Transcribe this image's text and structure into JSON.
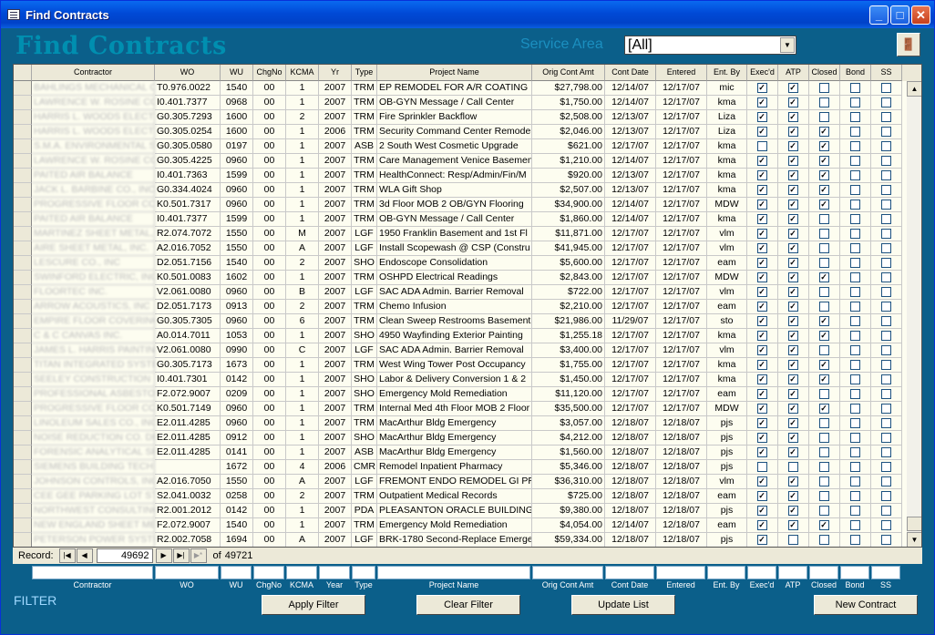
{
  "window": {
    "title": "Find Contracts"
  },
  "header": {
    "title": "Find Contracts",
    "service_area_label": "Service Area",
    "service_area_value": "[All]"
  },
  "grid": {
    "columns": [
      "Contractor",
      "WO",
      "WU",
      "ChgNo",
      "KCMA",
      "Yr",
      "Type",
      "Project Name",
      "Orig Cont  Amt",
      "Cont Date",
      "Entered",
      "Ent. By",
      "Exec'd",
      "ATP",
      "Closed",
      "Bond",
      "SS"
    ],
    "rows": [
      [
        "BAHLINGS MECHANICAL C",
        "T0.976.0022",
        "1540",
        "00",
        "1",
        "2007",
        "TRM",
        "EP REMODEL FOR A/R COATING",
        "$27,798.00",
        "12/14/07",
        "12/17/07",
        "mic",
        1,
        1,
        0,
        0,
        0
      ],
      [
        "LAWRENCE W. ROSINE CO",
        "I0.401.7377",
        "0968",
        "00",
        "1",
        "2007",
        "TRM",
        "OB-GYN Message / Call Center",
        "$1,750.00",
        "12/14/07",
        "12/17/07",
        "kma",
        1,
        1,
        0,
        0,
        0
      ],
      [
        "HARRIS L. WOODS ELECT",
        "G0.305.7293",
        "1600",
        "00",
        "2",
        "2007",
        "TRM",
        "Fire Sprinkler Backflow",
        "$2,508.00",
        "12/13/07",
        "12/17/07",
        "Liza",
        1,
        1,
        0,
        0,
        0
      ],
      [
        "HARRIS L. WOODS ELECT",
        "G0.305.0254",
        "1600",
        "00",
        "1",
        "2006",
        "TRM",
        "Security Command Center Remode",
        "$2,046.00",
        "12/13/07",
        "12/17/07",
        "Liza",
        1,
        1,
        1,
        0,
        0
      ],
      [
        "S.M.A. ENVIRONMENTAL S",
        "G0.305.0580",
        "0197",
        "00",
        "1",
        "2007",
        "ASB",
        "2 South West Cosmetic Upgrade",
        "$621.00",
        "12/17/07",
        "12/17/07",
        "kma",
        0,
        1,
        1,
        0,
        0
      ],
      [
        "LAWRENCE W. ROSINE CO",
        "G0.305.4225",
        "0960",
        "00",
        "1",
        "2007",
        "TRM",
        "Care Management Venice Basemen",
        "$1,210.00",
        "12/14/07",
        "12/17/07",
        "kma",
        1,
        1,
        1,
        0,
        0
      ],
      [
        "PAITED AIR BALANCE",
        "I0.401.7363",
        "1599",
        "00",
        "1",
        "2007",
        "TRM",
        "HealthConnect: Resp/Admin/Fin/M",
        "$920.00",
        "12/13/07",
        "12/17/07",
        "kma",
        1,
        1,
        1,
        0,
        0
      ],
      [
        "JACK L. BARBINE CO., INC",
        "G0.334.4024",
        "0960",
        "00",
        "1",
        "2007",
        "TRM",
        "WLA Gift Shop",
        "$2,507.00",
        "12/13/07",
        "12/17/07",
        "kma",
        1,
        1,
        1,
        0,
        0
      ],
      [
        "PROGRESSIVE FLOOR COV",
        "K0.501.7317",
        "0960",
        "00",
        "1",
        "2007",
        "TRM",
        "3d Floor MOB 2 OB/GYN Flooring",
        "$34,900.00",
        "12/14/07",
        "12/17/07",
        "MDW",
        1,
        1,
        1,
        0,
        0
      ],
      [
        "PAITED AIR BALANCE",
        "I0.401.7377",
        "1599",
        "00",
        "1",
        "2007",
        "TRM",
        "OB-GYN Message / Call Center",
        "$1,860.00",
        "12/14/07",
        "12/17/07",
        "kma",
        1,
        1,
        0,
        0,
        0
      ],
      [
        "MARTINEZ SHEET METAL, I",
        "R2.074.7072",
        "1550",
        "00",
        "M",
        "2007",
        "LGF",
        "1950 Franklin Basement and 1st Fl",
        "$11,871.00",
        "12/17/07",
        "12/17/07",
        "vlm",
        1,
        1,
        0,
        0,
        0
      ],
      [
        "AIRE SHEET METAL, INC.",
        "A2.016.7052",
        "1550",
        "00",
        "A",
        "2007",
        "LGF",
        "Install Scopewash @ CSP (Constru",
        "$41,945.00",
        "12/17/07",
        "12/17/07",
        "vlm",
        1,
        1,
        0,
        0,
        0
      ],
      [
        "LESCURE CO., INC",
        "D2.051.7156",
        "1540",
        "00",
        "2",
        "2007",
        "SHO",
        "Endoscope Consolidation",
        "$5,600.00",
        "12/17/07",
        "12/17/07",
        "eam",
        1,
        1,
        0,
        0,
        0
      ],
      [
        "SWINFORD ELECTRIC, INC",
        "K0.501.0083",
        "1602",
        "00",
        "1",
        "2007",
        "TRM",
        "OSHPD Electrical Readings",
        "$2,843.00",
        "12/17/07",
        "12/17/07",
        "MDW",
        1,
        1,
        1,
        0,
        0
      ],
      [
        "FLOORTEC INC.",
        "V2.061.0080",
        "0960",
        "00",
        "B",
        "2007",
        "LGF",
        "SAC ADA Admin. Barrier Removal",
        "$722.00",
        "12/17/07",
        "12/17/07",
        "vlm",
        1,
        1,
        0,
        0,
        0
      ],
      [
        "ARROW ACOUSTICS, INC",
        "D2.051.7173",
        "0913",
        "00",
        "2",
        "2007",
        "TRM",
        "Chemo Infusion",
        "$2,210.00",
        "12/17/07",
        "12/17/07",
        "eam",
        1,
        1,
        0,
        0,
        0
      ],
      [
        "EMPIRE FLOOR COVERING",
        "G0.305.7305",
        "0960",
        "00",
        "6",
        "2007",
        "TRM",
        "Clean Sweep Restrooms Basement",
        "$21,986.00",
        "11/29/07",
        "12/17/07",
        "sto",
        1,
        1,
        1,
        0,
        0
      ],
      [
        "C & C CANVAS INC.",
        "A0.014.7011",
        "1053",
        "00",
        "1",
        "2007",
        "SHO",
        "4950 Wayfinding Exterior Painting",
        "$1,255.18",
        "12/17/07",
        "12/17/07",
        "kma",
        1,
        1,
        1,
        0,
        0
      ],
      [
        "JAMES L. HARRIS PAINTIN",
        "V2.061.0080",
        "0990",
        "00",
        "C",
        "2007",
        "LGF",
        "SAC ADA Admin. Barrier Removal",
        "$3,400.00",
        "12/17/07",
        "12/17/07",
        "vlm",
        1,
        1,
        0,
        0,
        0
      ],
      [
        "TITAN INTEGRATED SYSTE",
        "G0.305.7173",
        "1673",
        "00",
        "1",
        "2007",
        "TRM",
        "West Wing Tower Post Occupancy",
        "$1,755.00",
        "12/17/07",
        "12/17/07",
        "kma",
        1,
        1,
        1,
        0,
        0
      ],
      [
        "SEELEY CONSTRUCTION",
        "I0.401.7301",
        "0142",
        "00",
        "1",
        "2007",
        "SHO",
        "Labor & Delivery Conversion 1 & 2",
        "$1,450.00",
        "12/17/07",
        "12/17/07",
        "kma",
        1,
        1,
        1,
        0,
        0
      ],
      [
        "PROFESSIONAL ASBESTOS",
        "F2.072.9007",
        "0209",
        "00",
        "1",
        "2007",
        "SHO",
        "Emergency Mold Remediation",
        "$11,120.00",
        "12/17/07",
        "12/17/07",
        "eam",
        1,
        1,
        0,
        0,
        0
      ],
      [
        "PROGRESSIVE FLOOR COV",
        "K0.501.7149",
        "0960",
        "00",
        "1",
        "2007",
        "TRM",
        "Internal Med 4th Floor MOB 2 Floor",
        "$35,500.00",
        "12/17/07",
        "12/17/07",
        "MDW",
        1,
        1,
        1,
        0,
        0
      ],
      [
        "LINOLEUM SALES CO., INC",
        "E2.011.4285",
        "0960",
        "00",
        "1",
        "2007",
        "TRM",
        "MacArthur Bldg Emergency",
        "$3,057.00",
        "12/18/07",
        "12/18/07",
        "pjs",
        1,
        1,
        0,
        0,
        0
      ],
      [
        "NOISE REDUCTION CO. DE",
        "E2.011.4285",
        "0912",
        "00",
        "1",
        "2007",
        "SHO",
        "MacArthur Bldg Emergency",
        "$4,212.00",
        "12/18/07",
        "12/18/07",
        "pjs",
        1,
        1,
        0,
        0,
        0
      ],
      [
        "FORENSIC ANALYTICAL SP",
        "E2.011.4285",
        "0141",
        "00",
        "1",
        "2007",
        "ASB",
        "MacArthur Bldg Emergency",
        "$1,560.00",
        "12/18/07",
        "12/18/07",
        "pjs",
        1,
        1,
        0,
        0,
        0
      ],
      [
        "SIEMENS BUILDING TECHN",
        "",
        "1672",
        "00",
        "4",
        "2006",
        "CMR",
        "Remodel Inpatient Pharmacy",
        "$5,346.00",
        "12/18/07",
        "12/18/07",
        "pjs",
        0,
        0,
        0,
        0,
        0
      ],
      [
        "JOHNSON CONTROLS, INC",
        "A2.016.7050",
        "1550",
        "00",
        "A",
        "2007",
        "LGF",
        "FREMONT ENDO REMODEL GI PRC",
        "$36,310.00",
        "12/18/07",
        "12/18/07",
        "vlm",
        1,
        1,
        0,
        0,
        0
      ],
      [
        "CEE GEE PARKING LOT STR",
        "S2.041.0032",
        "0258",
        "00",
        "2",
        "2007",
        "TRM",
        "Outpatient Medical Records",
        "$725.00",
        "12/18/07",
        "12/18/07",
        "eam",
        1,
        1,
        0,
        0,
        0
      ],
      [
        "NORTHWEST CONSULTING",
        "R2.001.2012",
        "0142",
        "00",
        "1",
        "2007",
        "PDA",
        "PLEASANTON ORACLE BUILDING F",
        "$9,380.00",
        "12/18/07",
        "12/18/07",
        "pjs",
        1,
        1,
        0,
        0,
        0
      ],
      [
        "NEW ENGLAND SHEET MET",
        "F2.072.9007",
        "1540",
        "00",
        "1",
        "2007",
        "TRM",
        "Emergency Mold Remediation",
        "$4,054.00",
        "12/14/07",
        "12/18/07",
        "eam",
        1,
        1,
        1,
        0,
        0
      ],
      [
        "PETERSON POWER SYSTE",
        "R2.002.7058",
        "1694",
        "00",
        "A",
        "2007",
        "LGF",
        "BRK-1780 Second-Replace Emerge",
        "$59,334.00",
        "12/18/07",
        "12/18/07",
        "pjs",
        1,
        0,
        0,
        0,
        0
      ]
    ]
  },
  "nav": {
    "record_label": "Record:",
    "current": "49692",
    "of_label": "of",
    "total": "49721",
    "first": "|◀",
    "prev": "◀",
    "next": "▶",
    "last": "▶|",
    "new": "▶*"
  },
  "filter": {
    "title": "FILTER",
    "labels": [
      "Contractor",
      "WO",
      "WU",
      "ChgNo",
      "KCMA",
      "Year",
      "Type",
      "Project Name",
      "Orig Cont Amt",
      "Cont Date",
      "Entered",
      "Ent. By",
      "Exec'd",
      "ATP",
      "Closed",
      "Bond",
      "SS"
    ],
    "buttons": {
      "apply": "Apply Filter",
      "clear": "Clear Filter",
      "update": "Update List",
      "new": "New Contract"
    }
  }
}
